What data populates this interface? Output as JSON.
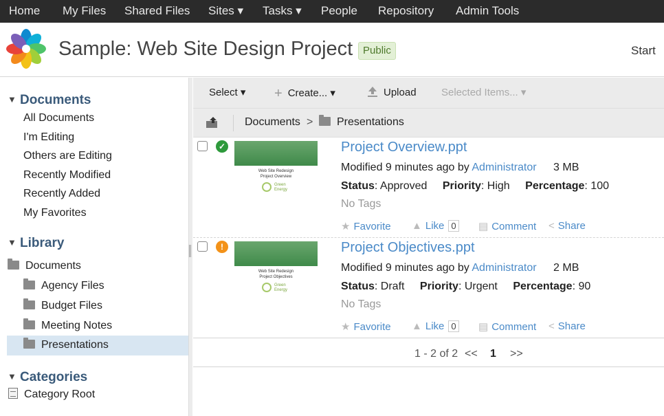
{
  "topnav": {
    "items": [
      "Home",
      "My Files",
      "Shared Files",
      "Sites ▾",
      "Tasks ▾",
      "People",
      "Repository",
      "Admin Tools"
    ]
  },
  "header": {
    "site_title": "Sample: Web Site Design Project",
    "visibility": "Public",
    "start": "Start"
  },
  "sidebar": {
    "documents_heading": "Documents",
    "documents_links": [
      "All Documents",
      "I'm Editing",
      "Others are Editing",
      "Recently Modified",
      "Recently Added",
      "My Favorites"
    ],
    "library_heading": "Library",
    "library_root": "Documents",
    "library_folders": [
      "Agency Files",
      "Budget Files",
      "Meeting Notes",
      "Presentations"
    ],
    "selected_folder": "Presentations",
    "categories_heading": "Categories",
    "category_root": "Category Root"
  },
  "toolbar": {
    "select": "Select ▾",
    "create": "Create... ▾",
    "upload": "Upload",
    "selected_items": "Selected Items... ▾"
  },
  "breadcrumb": {
    "root": "Documents",
    "separator": ">",
    "current": "Presentations"
  },
  "documents": [
    {
      "title": "Project Overview.ppt",
      "modified_prefix": "Modified 9 minutes ago by",
      "modified_by": "Administrator",
      "size": "3 MB",
      "status_label": "Status",
      "status": "Approved",
      "priority_label": "Priority",
      "priority": "High",
      "percentage_label": "Percentage",
      "percentage": "100",
      "tags": "No Tags",
      "thumb_line1": "Web Site Redesign",
      "thumb_line2": "Project Overview",
      "thumb_brand_1": "Green",
      "thumb_brand_2": "Energy",
      "status_icon": "check-circle-icon",
      "status_color": "#2e9a3c",
      "favorite": "Favorite",
      "like": "Like",
      "like_count": "0",
      "comment": "Comment",
      "share": "Share"
    },
    {
      "title": "Project Objectives.ppt",
      "modified_prefix": "Modified 9 minutes ago by",
      "modified_by": "Administrator",
      "size": "2 MB",
      "status_label": "Status",
      "status": "Draft",
      "priority_label": "Priority",
      "priority": "Urgent",
      "percentage_label": "Percentage",
      "percentage": "90",
      "tags": "No Tags",
      "thumb_line1": "Web Site Redesign",
      "thumb_line2": "Project Objectives",
      "thumb_brand_1": "Green",
      "thumb_brand_2": "Energy",
      "status_icon": "warning-icon",
      "status_color": "#f39219",
      "favorite": "Favorite",
      "like": "Like",
      "like_count": "0",
      "comment": "Comment",
      "share": "Share"
    }
  ],
  "pagination": {
    "range": "1 - 2 of 2",
    "prev": "<<",
    "page": "1",
    "next": ">>"
  }
}
